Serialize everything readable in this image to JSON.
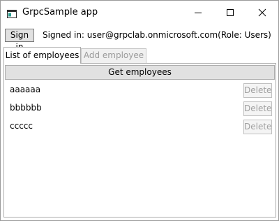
{
  "window": {
    "title": "GrpcSample app",
    "icons": {
      "app": "app-window-icon",
      "minimize": "minimize-icon",
      "maximize": "maximize-icon",
      "close": "close-icon"
    }
  },
  "header": {
    "sign_in_label": "Sign in",
    "signed_in_text": "Signed in: user@grpclab.onmicrosoft.com(Role: Users)"
  },
  "tabs": [
    {
      "label": "List of employees",
      "active": true
    },
    {
      "label": "Add employee",
      "active": false
    }
  ],
  "employees_panel": {
    "get_button_label": "Get employees",
    "rows": [
      {
        "name": "aaaaaa",
        "delete_label": "Delete"
      },
      {
        "name": "bbbbbb",
        "delete_label": "Delete"
      },
      {
        "name": "ccccc",
        "delete_label": "Delete"
      }
    ]
  },
  "colors": {
    "button_bg": "#e1e1e1",
    "disabled_text": "#a0a0a0",
    "border": "#acacac"
  }
}
